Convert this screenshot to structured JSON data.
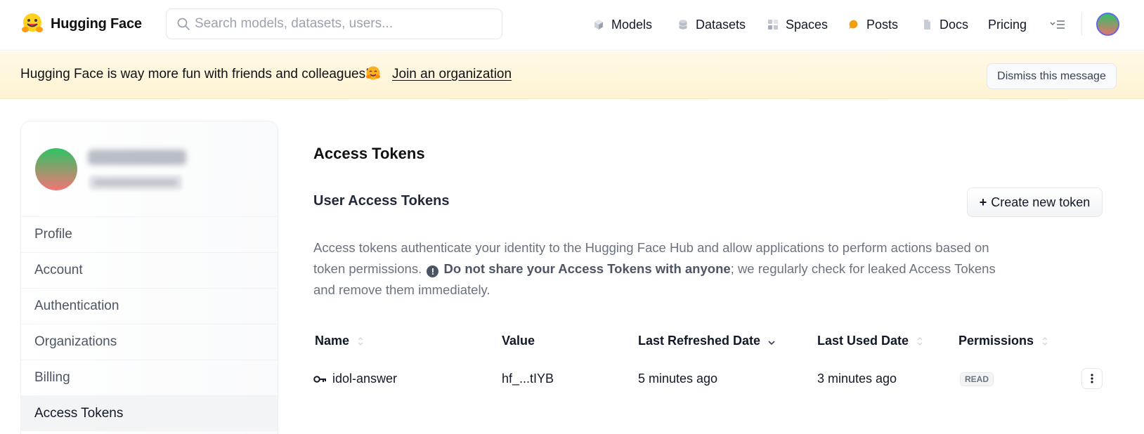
{
  "header": {
    "brand": "Hugging Face",
    "search_placeholder": "Search models, datasets, users...",
    "nav": [
      {
        "label": "Models",
        "icon": "cube-icon"
      },
      {
        "label": "Datasets",
        "icon": "database-icon"
      },
      {
        "label": "Spaces",
        "icon": "grid-icon"
      },
      {
        "label": "Posts",
        "icon": "chat-bubble-icon"
      },
      {
        "label": "Docs",
        "icon": "document-icon"
      },
      {
        "label": "Pricing",
        "icon": ""
      }
    ]
  },
  "banner": {
    "text": "Hugging Face is way more fun with friends and colleagues!",
    "link": "Join an organization",
    "dismiss": "Dismiss this message"
  },
  "sidebar": {
    "items": [
      {
        "label": "Profile"
      },
      {
        "label": "Account"
      },
      {
        "label": "Authentication"
      },
      {
        "label": "Organizations"
      },
      {
        "label": "Billing"
      },
      {
        "label": "Access Tokens"
      }
    ],
    "active": "Access Tokens"
  },
  "main": {
    "title": "Access Tokens",
    "section_title": "User Access Tokens",
    "create_button": "Create new token",
    "create_button_plus": "+",
    "description": {
      "part1": "Access tokens authenticate your identity to the Hugging Face Hub and allow applications to perform actions based on token permissions.",
      "warn_symbol": "!",
      "bold1": "Do not share your ",
      "bold2": "Access Tokens",
      "bold3": " with anyone",
      "part2": "; we regularly check for leaked Access Tokens and remove them immediately."
    },
    "table": {
      "columns": [
        "Name",
        "Value",
        "Last Refreshed Date",
        "Last Used Date",
        "Permissions"
      ],
      "rows": [
        {
          "name": "idol-answer",
          "value": "hf_...tIYB",
          "last_refreshed": "5 minutes ago",
          "last_used": "3 minutes ago",
          "permission": "READ"
        }
      ]
    }
  },
  "colors": {
    "banner_bg": "#fdf3d3",
    "accent_avatar_ring": "#6366f1",
    "posts_icon": "#f59e0b"
  }
}
